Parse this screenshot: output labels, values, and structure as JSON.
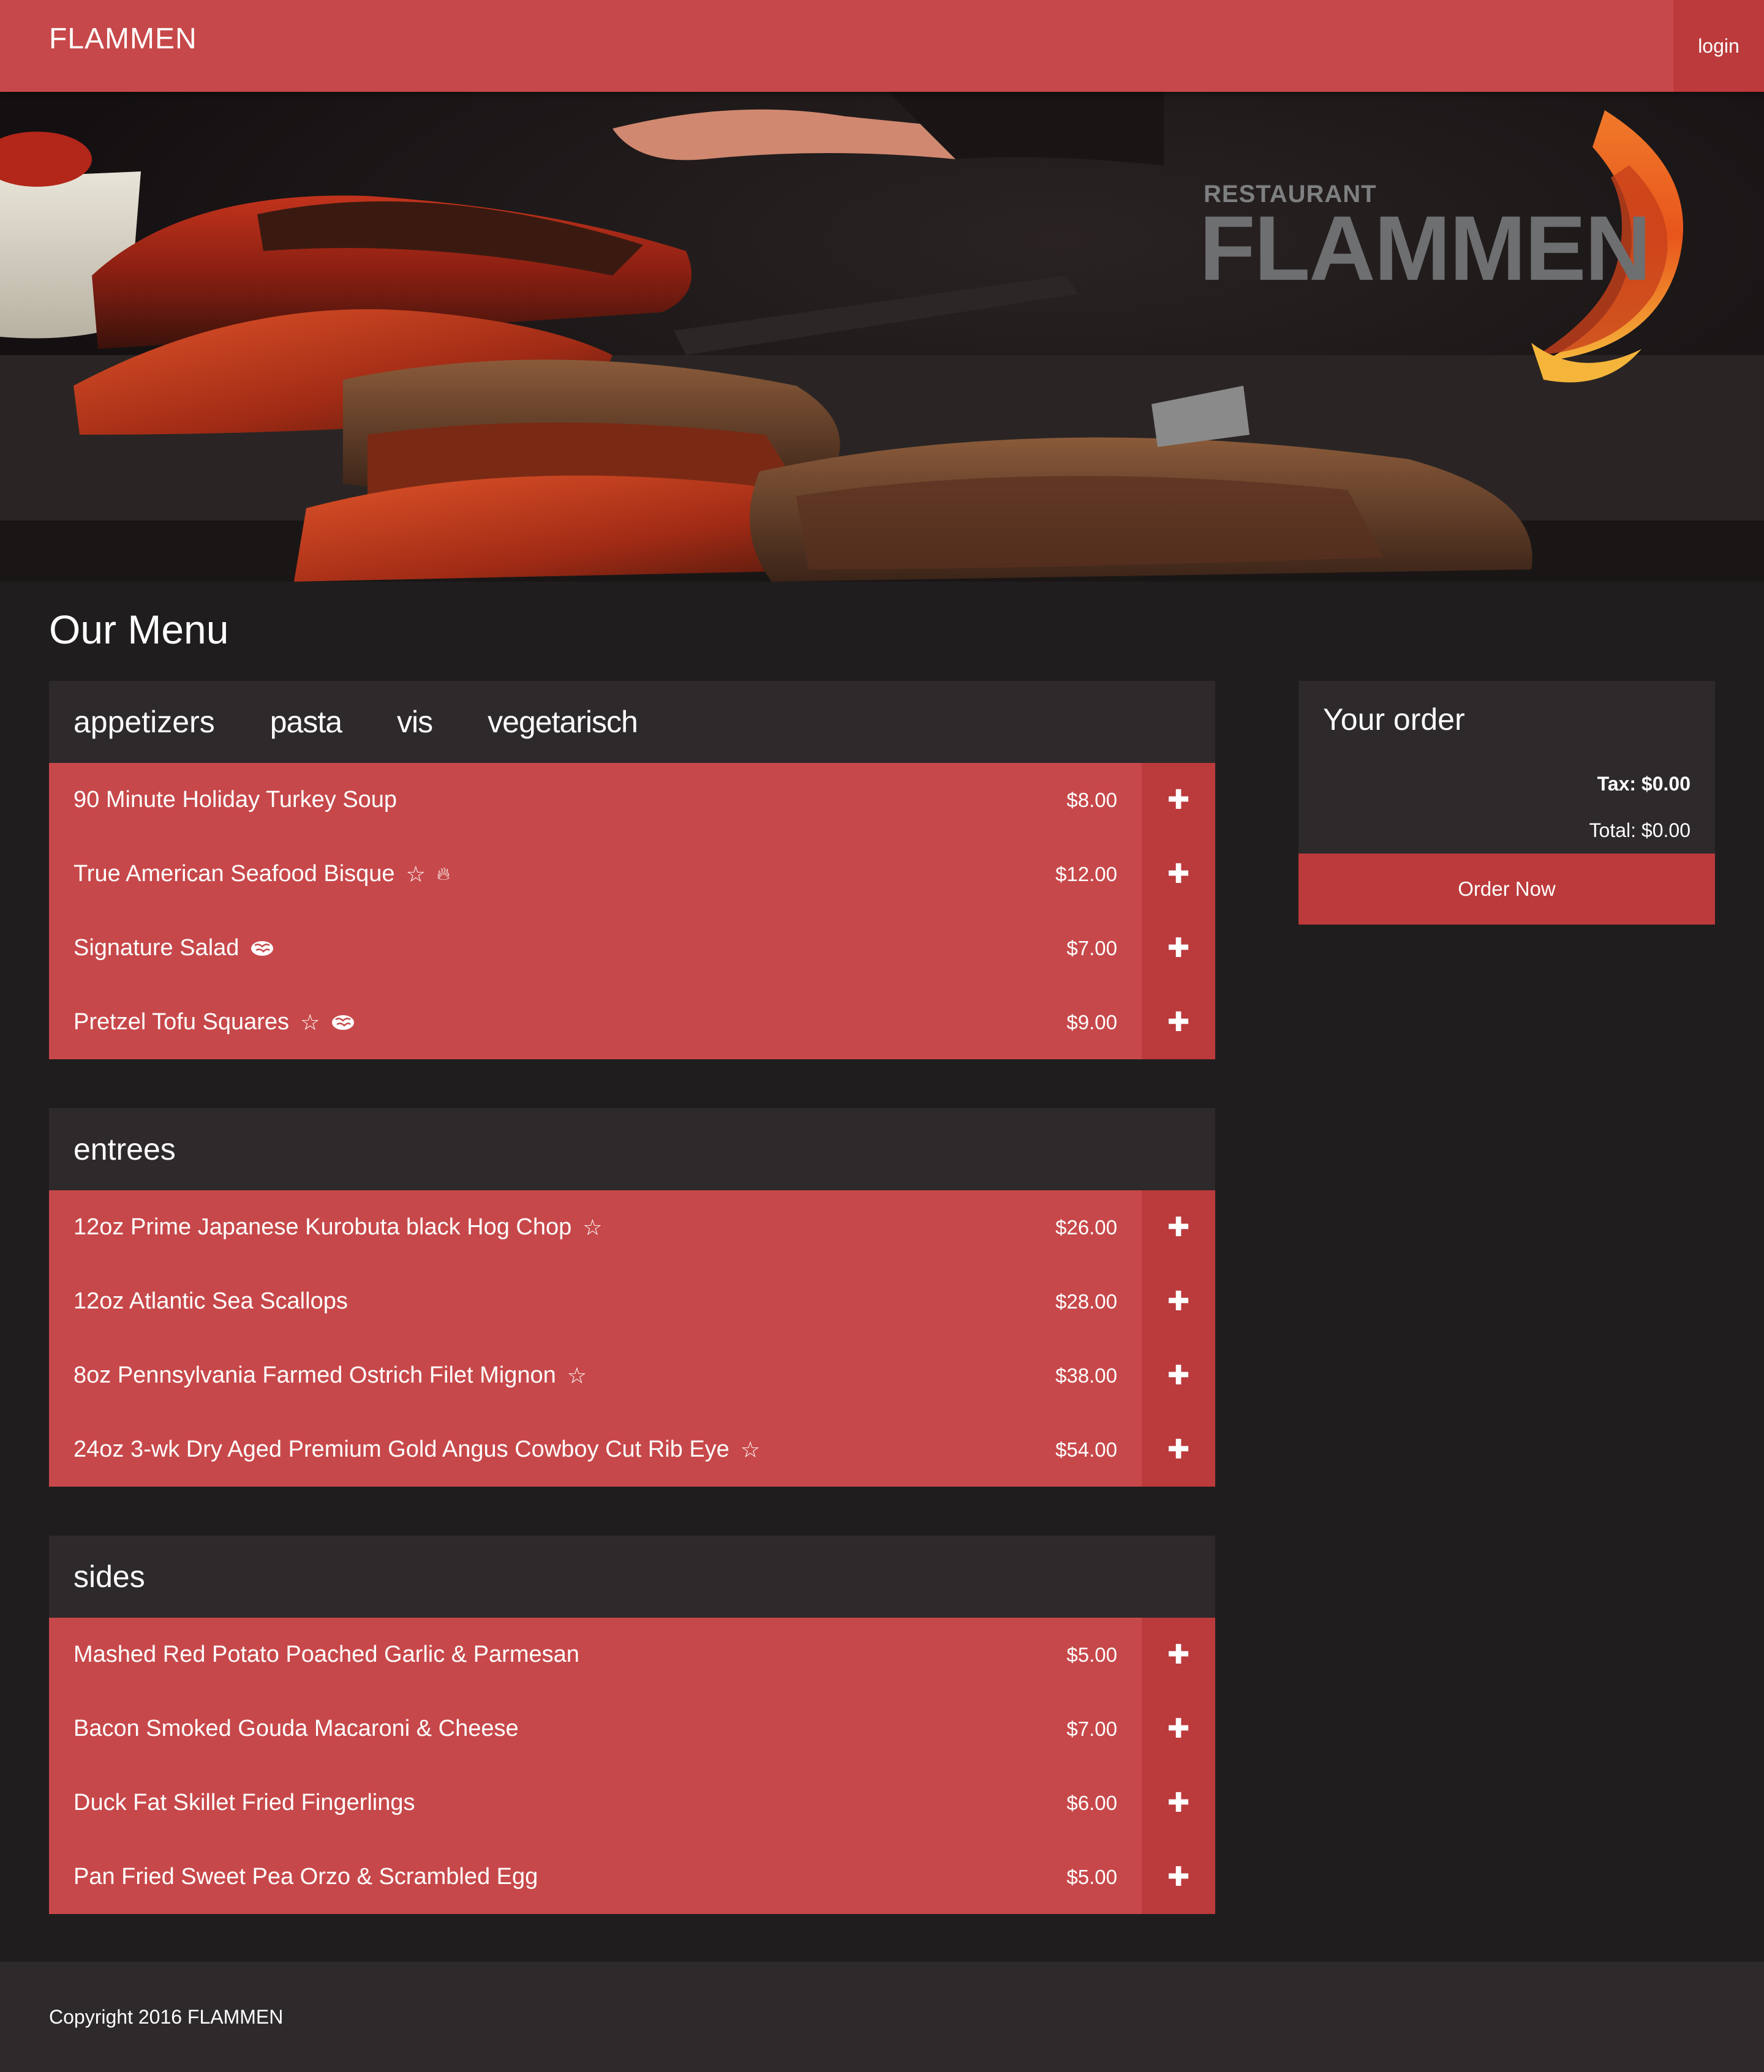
{
  "header": {
    "brand": "FLAMMEN",
    "login_label": "login"
  },
  "hero": {
    "logo_small": "RESTAURANT",
    "logo_big": "FLAMMEN"
  },
  "page": {
    "title": "Our Menu"
  },
  "menu_tabs": [
    "appetizers",
    "pasta",
    "vis",
    "vegetarisch"
  ],
  "appetizers": {
    "items": [
      {
        "name": "90 Minute Holiday Turkey Soup",
        "price": "$8.00",
        "icons": []
      },
      {
        "name": "True American Seafood Bisque",
        "price": "$12.00",
        "icons": [
          "star-icon",
          "flame-icon"
        ]
      },
      {
        "name": "Signature Salad",
        "price": "$7.00",
        "icons": [
          "brain-icon"
        ]
      },
      {
        "name": "Pretzel Tofu Squares",
        "price": "$9.00",
        "icons": [
          "star-icon",
          "brain-icon"
        ]
      }
    ]
  },
  "entrees": {
    "title": "entrees",
    "items": [
      {
        "name": "12oz Prime Japanese Kurobuta black Hog Chop",
        "price": "$26.00",
        "icons": [
          "star-icon"
        ]
      },
      {
        "name": "12oz Atlantic Sea Scallops",
        "price": "$28.00",
        "icons": []
      },
      {
        "name": "8oz Pennsylvania Farmed Ostrich Filet Mignon",
        "price": "$38.00",
        "icons": [
          "star-icon"
        ]
      },
      {
        "name": "24oz 3-wk Dry Aged Premium Gold Angus Cowboy Cut Rib Eye",
        "price": "$54.00",
        "icons": [
          "star-icon"
        ]
      }
    ]
  },
  "sides": {
    "title": "sides",
    "items": [
      {
        "name": "Mashed Red Potato Poached Garlic & Parmesan",
        "price": "$5.00",
        "icons": []
      },
      {
        "name": "Bacon Smoked Gouda Macaroni & Cheese",
        "price": "$7.00",
        "icons": []
      },
      {
        "name": "Duck Fat Skillet Fried Fingerlings",
        "price": "$6.00",
        "icons": []
      },
      {
        "name": "Pan Fried Sweet Pea Orzo & Scrambled Egg",
        "price": "$5.00",
        "icons": []
      }
    ]
  },
  "add_glyph": "✚",
  "order": {
    "title": "Your order",
    "tax": "Tax: $0.00",
    "total": "Total: $0.00",
    "button_label": "Order Now"
  },
  "footer": {
    "copyright": "Copyright 2016 FLAMMEN"
  },
  "colors": {
    "accent": "#c7484a",
    "accent_dark": "#bc3a3b",
    "panel": "#2e292a",
    "background": "#201d1e"
  }
}
